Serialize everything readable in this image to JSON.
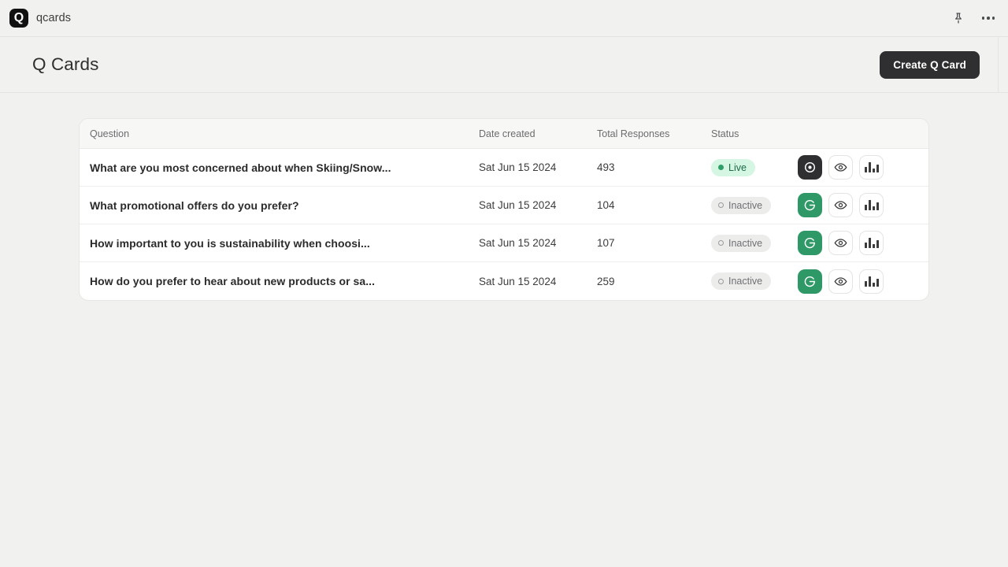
{
  "appbar": {
    "logo_letter": "Q",
    "brand": "qcards",
    "pin_icon": "pin-icon",
    "more_icon": "more-options-icon"
  },
  "header": {
    "title": "Q Cards",
    "create_button": "Create Q Card"
  },
  "table": {
    "columns": [
      "Question",
      "Date created",
      "Total Responses",
      "Status"
    ],
    "rows": [
      {
        "question": "What are you most concerned about when Skiing/Snow...",
        "date": "Sat Jun 15 2024",
        "total": "493",
        "status": "Live",
        "status_type": "live",
        "toggle_state": "dark"
      },
      {
        "question": "What promotional offers do you prefer?",
        "date": "Sat Jun 15 2024",
        "total": "104",
        "status": "Inactive",
        "status_type": "inactive",
        "toggle_state": "green"
      },
      {
        "question": "How important to you is sustainability when choosi...",
        "date": "Sat Jun 15 2024",
        "total": "107",
        "status": "Inactive",
        "status_type": "inactive",
        "toggle_state": "green"
      },
      {
        "question": "How do you prefer to hear about new products or sa...",
        "date": "Sat Jun 15 2024",
        "total": "259",
        "status": "Inactive",
        "status_type": "inactive",
        "toggle_state": "green"
      }
    ],
    "action_icons": [
      "status-toggle-icon",
      "preview-eye-icon",
      "analytics-bar-chart-icon"
    ]
  },
  "colors": {
    "page_bg": "#f1f1f0",
    "accent_dark": "#2f2f31",
    "accent_green": "#2e9966",
    "live_badge_bg": "#d5f6e3",
    "inactive_badge_bg": "#ececeb"
  }
}
